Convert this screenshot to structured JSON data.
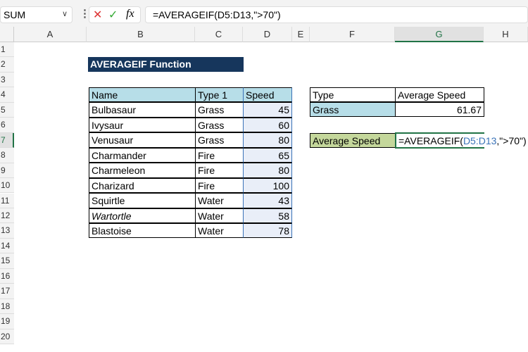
{
  "name_box": "SUM",
  "formula_bar": "=AVERAGEIF(D5:D13,\">70\")",
  "columns": [
    "A",
    "B",
    "C",
    "D",
    "E",
    "F",
    "G",
    "H"
  ],
  "rows": [
    "1",
    "2",
    "3",
    "4",
    "5",
    "6",
    "7",
    "8",
    "9",
    "10",
    "11",
    "12",
    "13",
    "14",
    "15",
    "16",
    "17",
    "18",
    "19",
    "20"
  ],
  "title": "AVERAGEIF Function",
  "table": {
    "headers": [
      "Name",
      "Type 1",
      "Speed"
    ],
    "rows": [
      [
        "Bulbasaur",
        "Grass",
        "45"
      ],
      [
        "Ivysaur",
        "Grass",
        "60"
      ],
      [
        "Venusaur",
        "Grass",
        "80"
      ],
      [
        "Charmander",
        "Fire",
        "65"
      ],
      [
        "Charmeleon",
        "Fire",
        "80"
      ],
      [
        "Charizard",
        "Fire",
        "100"
      ],
      [
        "Squirtle",
        "Water",
        "43"
      ],
      [
        "Wartortle",
        "Water",
        "58"
      ],
      [
        "Blastoise",
        "Water",
        "78"
      ]
    ]
  },
  "summary": {
    "h1": "Type",
    "h2": "Average Speed",
    "type": "Grass",
    "avg": "61.67"
  },
  "avg_label": "Average Speed",
  "edit": {
    "pre": "=AVERAGEIF(",
    "ref": "D5:D13",
    "post": ",\">70\")"
  },
  "colors": {
    "title_bg": "#16365c",
    "header_bg": "#b7dee8",
    "label_bg": "#c4d79b",
    "range_bg": "#e9eef8",
    "accent": "#217346"
  }
}
